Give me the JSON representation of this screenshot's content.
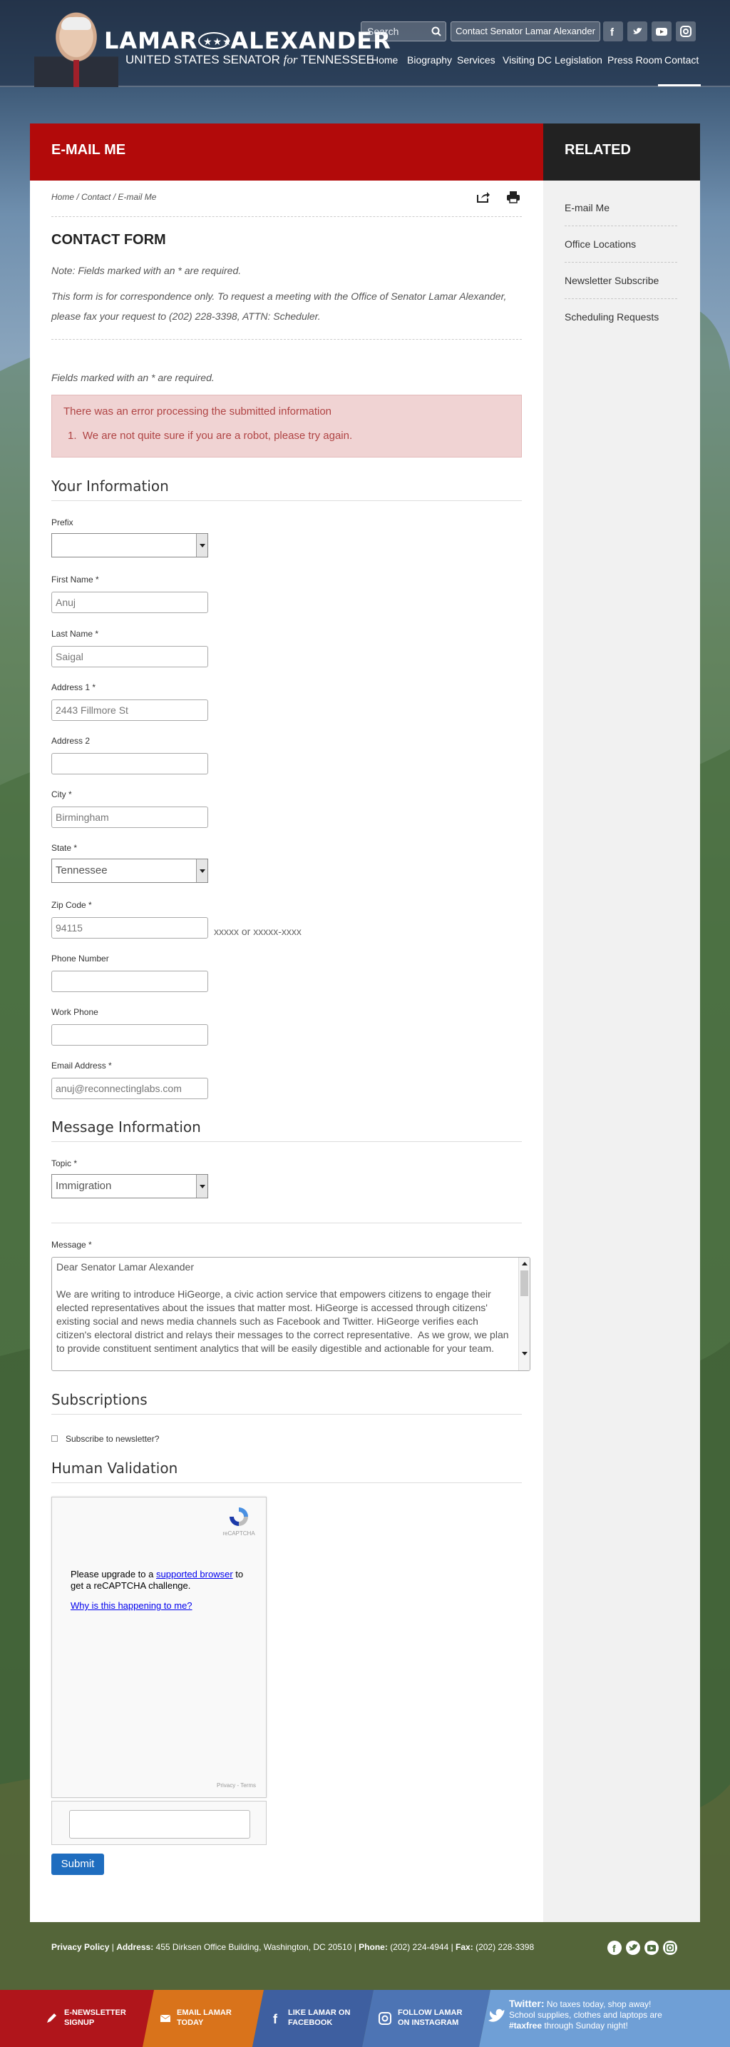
{
  "header": {
    "name_part1": "LAMAR",
    "name_part2": "ALEXANDER",
    "subtitle_pre": "UNITED STATES SENATOR",
    "subtitle_for": "for",
    "subtitle_post": "TENNESSEE",
    "search_placeholder": "Search",
    "contact_button": "Contact Senator Lamar Alexander",
    "nav": [
      "Home",
      "Biography",
      "Services",
      "Visiting DC",
      "Legislation",
      "Press Room",
      "Contact"
    ],
    "active_nav": "Contact"
  },
  "main": {
    "header_title": "E-MAIL ME",
    "breadcrumb": [
      "Home",
      "Contact",
      "E-mail Me"
    ],
    "page_title": "CONTACT FORM",
    "note": "Note: Fields marked with an * are required.",
    "info": "This form is for correspondence only.  To request a meeting with the Office of Senator Lamar Alexander, please fax your request to (202) 228-3398, ATTN: Scheduler.",
    "required_note": "Fields marked with an * are required.",
    "error_title": "There was an error processing the submitted information",
    "error_item_number": "1.",
    "error_item": "We are not quite sure if you are a robot, please try again."
  },
  "sidebar": {
    "title": "RELATED",
    "links": [
      "E-mail Me",
      "Office Locations",
      "Newsletter Subscribe",
      "Scheduling Requests"
    ]
  },
  "form": {
    "your_info_title": "Your Information",
    "prefix_label": "Prefix",
    "prefix_value": "",
    "first_name_label": "First Name *",
    "first_name": "Anuj",
    "last_name_label": "Last Name *",
    "last_name": "Saigal",
    "address1_label": "Address 1 *",
    "address1": "2443 Fillmore St",
    "address2_label": "Address 2",
    "address2": "",
    "city_label": "City *",
    "city": "Birmingham",
    "state_label": "State *",
    "state": "Tennessee",
    "zip_label": "Zip Code *",
    "zip": "94115",
    "zip_hint": "xxxxx or xxxxx-xxxx",
    "phone_label": "Phone Number",
    "phone": "",
    "work_phone_label": "Work Phone",
    "work_phone": "",
    "email_label": "Email Address *",
    "email": "anuj@reconnectinglabs.com",
    "message_info_title": "Message Information",
    "topic_label": "Topic *",
    "topic": "Immigration",
    "message_label": "Message *",
    "message": "Dear Senator Lamar Alexander\n\nWe are writing to introduce HiGeorge, a civic action service that empowers citizens to engage their elected representatives about the issues that matter most. HiGeorge is accessed through citizens' existing social and news media channels such as Facebook and Twitter. HiGeorge verifies each citizen's electoral district and relays their messages to the correct representative.  As we grow, we plan to provide constituent sentiment analytics that will be easily digestible and actionable for your team.",
    "subscriptions_title": "Subscriptions",
    "newsletter_label": "Subscribe to newsletter?",
    "validation_title": "Human Validation",
    "captcha_brand": "reCAPTCHA",
    "captcha_upgrade_pre": "Please upgrade to a",
    "captcha_upgrade_link": "supported browser",
    "captcha_upgrade_post": "to get a reCAPTCHA challenge.",
    "captcha_why": "Why is this happening to me?",
    "captcha_privacy": "Privacy - Terms",
    "submit_label": "Submit"
  },
  "footer": {
    "privacy": "Privacy Policy",
    "address_label": "Address:",
    "address": "455 Dirksen Office Building, Washington, DC 20510",
    "phone_label": "Phone:",
    "phone": "(202) 224-4944",
    "fax_label": "Fax:",
    "fax": "(202) 228-3398"
  },
  "bottom_bar": {
    "newsletter": [
      "E-NEWSLETTER",
      "SIGNUP"
    ],
    "email": [
      "EMAIL LAMAR",
      "TODAY"
    ],
    "facebook": [
      "LIKE LAMAR ON",
      "FACEBOOK"
    ],
    "instagram": [
      "FOLLOW LAMAR",
      "ON INSTAGRAM"
    ],
    "twitter_label": "Twitter:",
    "twitter_text1": "No taxes today, shop away!",
    "twitter_text2": "School supplies, clothes and laptops are",
    "twitter_hashtag": "#taxfree",
    "twitter_text3": "through Sunday night!"
  },
  "colors": {
    "brand_red": "#b20a0a",
    "related_dark": "#222222",
    "submit_blue": "#1f6dbf",
    "bar_red": "#b0151b",
    "bar_orange": "#d9731b",
    "bar_blue1": "#3e5fa0",
    "bar_blue2": "#4d74b4",
    "bar_light_blue": "#6f9fd6"
  }
}
